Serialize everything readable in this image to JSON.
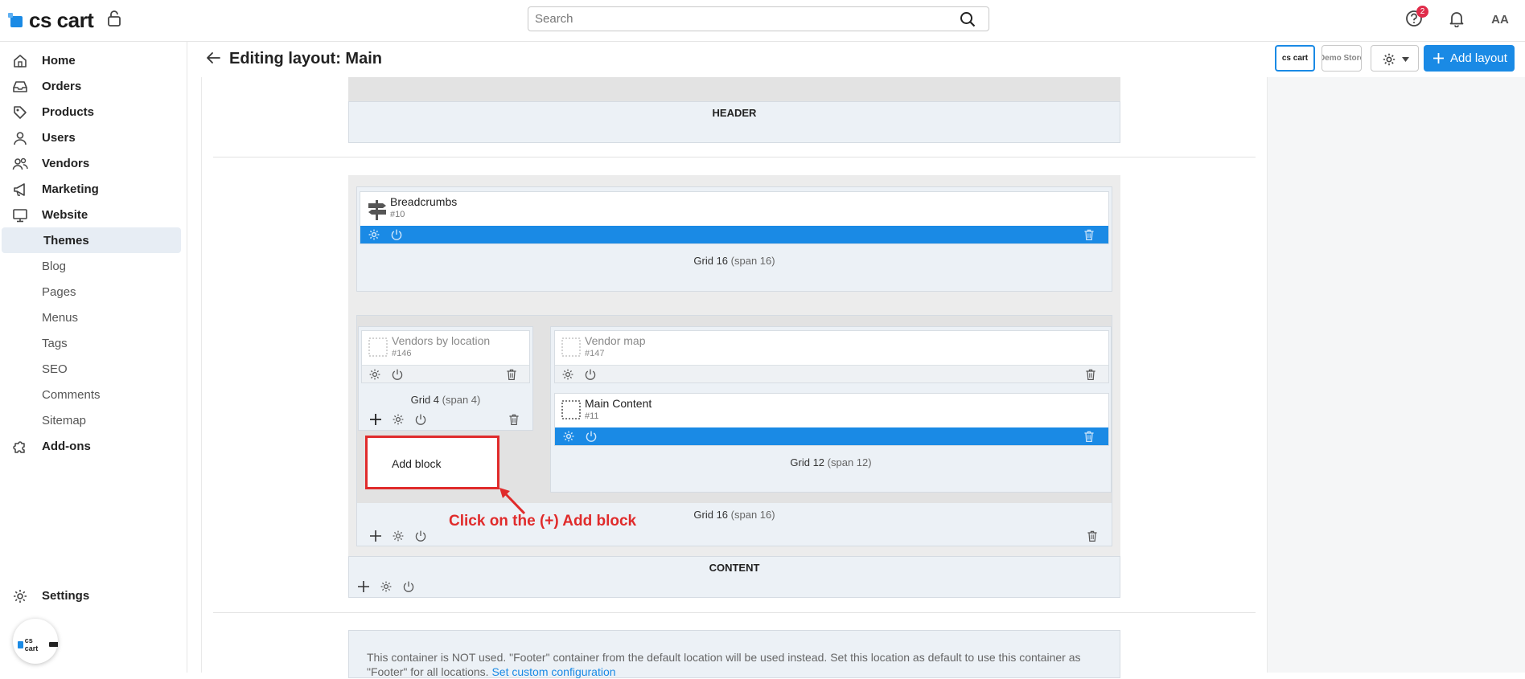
{
  "app": {
    "logo_text": "cs cart"
  },
  "search": {
    "placeholder": "Search"
  },
  "header": {
    "notification_count": "2",
    "avatar_initials": "AA"
  },
  "sidebar": {
    "items": [
      {
        "label": "Home",
        "icon": "home-icon"
      },
      {
        "label": "Orders",
        "icon": "inbox-icon"
      },
      {
        "label": "Products",
        "icon": "tag-icon"
      },
      {
        "label": "Users",
        "icon": "user-icon"
      },
      {
        "label": "Vendors",
        "icon": "users-icon"
      },
      {
        "label": "Marketing",
        "icon": "megaphone-icon"
      },
      {
        "label": "Website",
        "icon": "monitor-icon"
      },
      {
        "label": "Themes",
        "active": true
      },
      {
        "label": "Blog"
      },
      {
        "label": "Pages"
      },
      {
        "label": "Menus"
      },
      {
        "label": "Tags"
      },
      {
        "label": "SEO"
      },
      {
        "label": "Comments"
      },
      {
        "label": "Sitemap"
      },
      {
        "label": "Add-ons",
        "icon": "puzzle-icon"
      }
    ],
    "settings_label": "Settings",
    "store_bubble_text": "cs cart"
  },
  "page": {
    "title": "Editing layout: Main",
    "store_thumbs": [
      "cs cart",
      "Demo Store"
    ],
    "add_layout_label": "Add layout"
  },
  "layout": {
    "header_label": "HEADER",
    "content_label": "CONTENT",
    "grid_top": {
      "name": "Grid 16",
      "span": "(span 16)"
    },
    "grid_left": {
      "name": "Grid 4",
      "span": "(span 4)"
    },
    "grid_right": {
      "name": "Grid 12",
      "span": "(span 12)"
    },
    "grid_bottom": {
      "name": "Grid 16",
      "span": "(span 16)"
    },
    "blocks": {
      "breadcrumbs": {
        "name": "Breadcrumbs",
        "id": "#10"
      },
      "vendors_by_location": {
        "name": "Vendors by location",
        "id": "#146"
      },
      "vendor_map": {
        "name": "Vendor map",
        "id": "#147"
      },
      "main_content": {
        "name": "Main Content",
        "id": "#11"
      }
    },
    "add_block_label": "Add block",
    "annotation": "Click on the (+) Add block",
    "footer_note": "This container is NOT used. \"Footer\" container from the default location will be used instead. Set this location as default to use this container as \"Footer\" for all locations.",
    "footer_link": "Set custom configuration"
  },
  "colors": {
    "accent": "#1a8ae5",
    "annotation": "#e02b2b",
    "badge": "#e02c4a"
  }
}
